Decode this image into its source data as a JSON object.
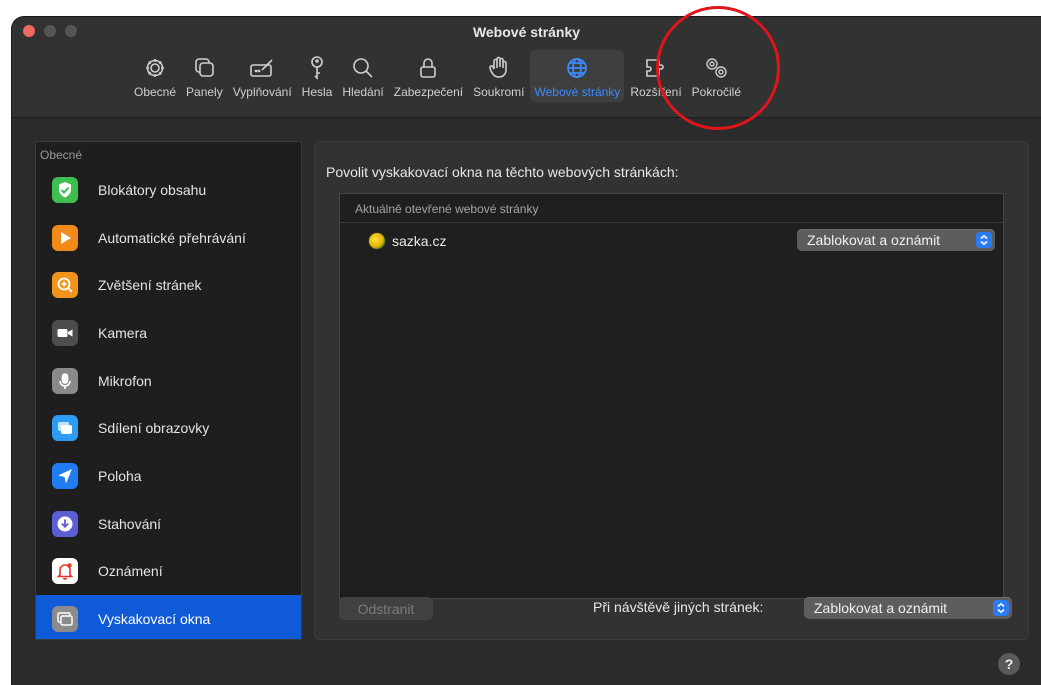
{
  "window": {
    "title": "Webové stránky"
  },
  "toolbar": {
    "items": [
      {
        "label": "Obecné",
        "icon": "gear-icon"
      },
      {
        "label": "Panely",
        "icon": "tabs-icon"
      },
      {
        "label": "Vyplňování",
        "icon": "pencil-field-icon"
      },
      {
        "label": "Hesla",
        "icon": "key-icon"
      },
      {
        "label": "Hledání",
        "icon": "magnifier-icon"
      },
      {
        "label": "Zabezpečení",
        "icon": "lock-icon"
      },
      {
        "label": "Soukromí",
        "icon": "hand-icon"
      },
      {
        "label": "Webové stránky",
        "icon": "globe-icon",
        "active": true
      },
      {
        "label": "Rozšíření",
        "icon": "puzzle-icon"
      },
      {
        "label": "Pokročilé",
        "icon": "gears-icon"
      }
    ]
  },
  "sidebar": {
    "header": "Obecné",
    "items": [
      {
        "label": "Blokátory obsahu",
        "icon": "shield-check-icon",
        "color": "#3fbf4f"
      },
      {
        "label": "Automatické přehrávání",
        "icon": "play-icon",
        "color": "#f28a1a"
      },
      {
        "label": "Zvětšení stránek",
        "icon": "zoom-icon",
        "color": "#f0941d"
      },
      {
        "label": "Kamera",
        "icon": "camera-icon",
        "color": "#4d4d4d"
      },
      {
        "label": "Mikrofon",
        "icon": "microphone-icon",
        "color": "#8a8a8a"
      },
      {
        "label": "Sdílení obrazovky",
        "icon": "screen-share-icon",
        "color": "#2f9cf4"
      },
      {
        "label": "Poloha",
        "icon": "location-arrow-icon",
        "color": "#1f7cf3"
      },
      {
        "label": "Stahování",
        "icon": "download-icon",
        "color": "#5b5fd6"
      },
      {
        "label": "Oznámení",
        "icon": "bell-icon",
        "color": "#ffffff"
      },
      {
        "label": "Vyskakovací okna",
        "icon": "popup-windows-icon",
        "color": "#8b8b8b",
        "selected": true
      }
    ]
  },
  "content": {
    "heading": "Povolit vyskakovací okna na těchto webových stránkách:",
    "table_header": "Aktuálně otevřené webové stránky",
    "sites": [
      {
        "name": "sazka.cz",
        "setting": "Zablokovat a oznámit"
      }
    ],
    "remove_button": "Odstranit",
    "other_sites_label": "Při návštěvě jiných stránek:",
    "other_sites_value": "Zablokovat a oznámit"
  },
  "help": "?"
}
